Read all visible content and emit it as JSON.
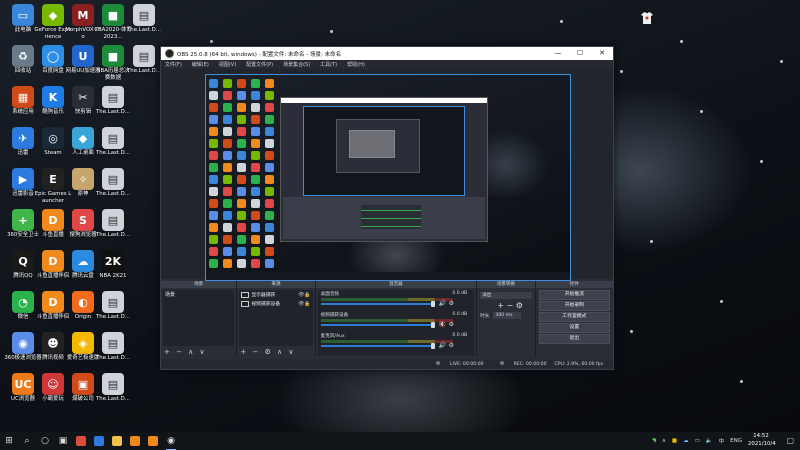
{
  "desktop": {
    "icons": [
      {
        "label": "此电脑",
        "color": "#3a86d9",
        "glyph": "▭",
        "col": 0,
        "row": 0
      },
      {
        "label": "GeForce Experience",
        "color": "#76b900",
        "glyph": "◆",
        "col": 1,
        "row": 0
      },
      {
        "label": "MorphVOX Pro",
        "color": "#8a2020",
        "glyph": "M",
        "col": 2,
        "row": 0
      },
      {
        "label": "CBA2020-体育2023...",
        "color": "#1c8c3a",
        "glyph": "■",
        "col": 3,
        "row": 0
      },
      {
        "label": "The.Last.D...",
        "color": "#cfd3da",
        "glyph": "▤",
        "col": 3.7,
        "row": 0
      },
      {
        "label": "回收站",
        "color": "#6b7a8a",
        "glyph": "♻",
        "col": 0,
        "row": 1
      },
      {
        "label": "百度网盘",
        "color": "#2e8ee6",
        "glyph": "◯",
        "col": 1,
        "row": 1
      },
      {
        "label": "网易UU加速器",
        "color": "#2266cc",
        "glyph": "U",
        "col": 2,
        "row": 1
      },
      {
        "label": "NBA历届总决赛数据",
        "color": "#1c8c3a",
        "glyph": "■",
        "col": 3,
        "row": 1
      },
      {
        "label": "The.Last.D...",
        "color": "#cfd3da",
        "glyph": "▤",
        "col": 3.7,
        "row": 1
      },
      {
        "label": "系统应用",
        "color": "#d04a1a",
        "glyph": "▦",
        "col": 0,
        "row": 2
      },
      {
        "label": "酷狗音乐",
        "color": "#1f7be6",
        "glyph": "K",
        "col": 1,
        "row": 2
      },
      {
        "label": "快剪辑",
        "color": "#2a2d36",
        "glyph": "✂",
        "col": 2,
        "row": 2
      },
      {
        "label": "The.Last.D...",
        "color": "#cfd3da",
        "glyph": "▤",
        "col": 3,
        "row": 2
      },
      {
        "label": "迅雷",
        "color": "#2d7be0",
        "glyph": "✈",
        "col": 0,
        "row": 3
      },
      {
        "label": "Steam",
        "color": "#1b2838",
        "glyph": "◎",
        "col": 1,
        "row": 3
      },
      {
        "label": "人工桌面",
        "color": "#3aa6d8",
        "glyph": "◆",
        "col": 2,
        "row": 3
      },
      {
        "label": "The.Last.D...",
        "color": "#cfd3da",
        "glyph": "▤",
        "col": 3,
        "row": 3
      },
      {
        "label": "迅雷影音",
        "color": "#2d7be0",
        "glyph": "▶",
        "col": 0,
        "row": 4
      },
      {
        "label": "Epic Games Launcher",
        "color": "#222222",
        "glyph": "E",
        "col": 1,
        "row": 4
      },
      {
        "label": "原神",
        "color": "#c7a66e",
        "glyph": "✧",
        "col": 2,
        "row": 4
      },
      {
        "label": "The.Last.D...",
        "color": "#cfd3da",
        "glyph": "▤",
        "col": 3,
        "row": 4
      },
      {
        "label": "360安全卫士",
        "color": "#3fb54a",
        "glyph": "+",
        "col": 0,
        "row": 5
      },
      {
        "label": "斗鱼直播",
        "color": "#f08a1c",
        "glyph": "D",
        "col": 1,
        "row": 5
      },
      {
        "label": "搜狗浏览器",
        "color": "#e04848",
        "glyph": "S",
        "col": 2,
        "row": 5
      },
      {
        "label": "The.Last.D...",
        "color": "#cfd3da",
        "glyph": "▤",
        "col": 3,
        "row": 5
      },
      {
        "label": "腾讯QQ",
        "color": "#1a1a1a",
        "glyph": "Q",
        "col": 0,
        "row": 6
      },
      {
        "label": "斗鱼直播伴侣",
        "color": "#f08a1c",
        "glyph": "D",
        "col": 1,
        "row": 6
      },
      {
        "label": "腾讯云盘",
        "color": "#2a8be0",
        "glyph": "☁",
        "col": 2,
        "row": 6
      },
      {
        "label": "NBA 2K21",
        "color": "#101010",
        "glyph": "2K",
        "col": 3,
        "row": 6
      },
      {
        "label": "微信",
        "color": "#2bb24c",
        "glyph": "◔",
        "col": 0,
        "row": 7
      },
      {
        "label": "斗鱼直播伴侣",
        "color": "#f08a1c",
        "glyph": "D",
        "col": 1,
        "row": 7
      },
      {
        "label": "Origin",
        "color": "#f26b1d",
        "glyph": "◐",
        "col": 2,
        "row": 7
      },
      {
        "label": "The.Last.D...",
        "color": "#cfd3da",
        "glyph": "▤",
        "col": 3,
        "row": 7
      },
      {
        "label": "360极速浏览器",
        "color": "#5b8de8",
        "glyph": "◉",
        "col": 0,
        "row": 8
      },
      {
        "label": "腾讯视频",
        "color": "#222222",
        "glyph": "☻",
        "col": 1,
        "row": 8
      },
      {
        "label": "爱奇艺极速版",
        "color": "#f5b800",
        "glyph": "◈",
        "col": 2,
        "row": 8
      },
      {
        "label": "The.Last.D...",
        "color": "#cfd3da",
        "glyph": "▤",
        "col": 3,
        "row": 8
      },
      {
        "label": "UC浏览器",
        "color": "#f07a1a",
        "glyph": "UC",
        "col": 0,
        "row": 9
      },
      {
        "label": "小霸爱玩",
        "color": "#d03838",
        "glyph": "☺",
        "col": 1,
        "row": 9
      },
      {
        "label": "爆破公司",
        "color": "#d04a1a",
        "glyph": "▣",
        "col": 2,
        "row": 9
      },
      {
        "label": "The.Last.D...",
        "color": "#cfd3da",
        "glyph": "▤",
        "col": 3,
        "row": 9
      }
    ]
  },
  "obs": {
    "title": "OBS 25.0.8 (64 bit, windows) - 配置文件: 未命名 - 场景: 未命名",
    "window_controls": [
      "—",
      "☐",
      "✕"
    ],
    "menu": [
      "文件(F)",
      "编辑(E)",
      "视图(V)",
      "配置文件(P)",
      "场景集合(S)",
      "工具(T)",
      "帮助(H)"
    ],
    "docks": {
      "scenes": {
        "title": "场景",
        "items": [
          "场景"
        ],
        "footer": "+ − ∧ ∨"
      },
      "sources": {
        "title": "来源",
        "items": [
          "显示器捕获",
          "视频捕获设备"
        ],
        "footer": "+ − ⚙ ∧ ∨"
      },
      "mixer": {
        "title": "混音器",
        "channels": [
          {
            "name": "桌面音频",
            "db": "0.0 dB",
            "muted": false
          },
          {
            "name": "视频捕获设备",
            "db": "0.0 dB",
            "muted": true
          },
          {
            "name": "麦克风/Aux",
            "db": "0.0 dB",
            "muted": false
          }
        ]
      },
      "transitions": {
        "title": "场景转换",
        "selected": "淡出",
        "duration_label": "时长",
        "duration_value": "300 ms"
      },
      "controls": {
        "title": "控件",
        "buttons": [
          "开始推流",
          "开始录制",
          "工作室模式",
          "设置",
          "退出"
        ]
      }
    },
    "status": {
      "live": "LIVE: 00:00:00",
      "rec": "REC: 00:00:00",
      "cpu": "CPU: 2.9%, 60.00 fps"
    }
  },
  "taskbar": {
    "items": [
      {
        "name": "start",
        "glyph": "⊞",
        "color": ""
      },
      {
        "name": "search",
        "glyph": "⌕",
        "color": ""
      },
      {
        "name": "cortana",
        "glyph": "○",
        "color": ""
      },
      {
        "name": "task-view",
        "glyph": "▣",
        "color": ""
      },
      {
        "name": "chrome",
        "glyph": "",
        "color": "#dd4b39"
      },
      {
        "name": "browser",
        "glyph": "",
        "color": "#2d7be0"
      },
      {
        "name": "file-explorer",
        "glyph": "",
        "color": "#f2c14e"
      },
      {
        "name": "douyu",
        "glyph": "",
        "color": "#f08a1c"
      },
      {
        "name": "douyu-2",
        "glyph": "",
        "color": "#f08a1c"
      },
      {
        "name": "obs",
        "glyph": "◉",
        "color": ""
      }
    ],
    "tray_language": "ENG",
    "time": "14:52",
    "date": "2021/10/4"
  }
}
